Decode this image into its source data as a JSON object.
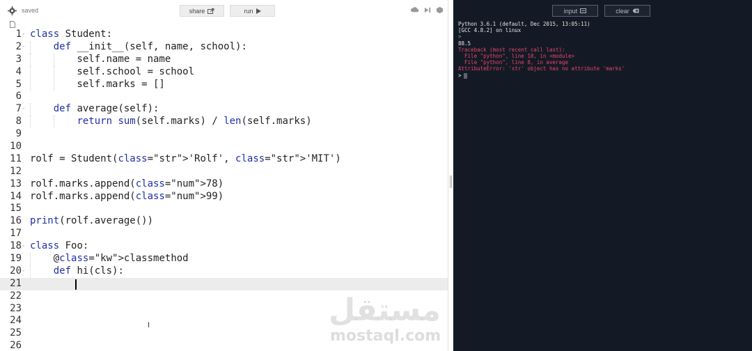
{
  "toolbar": {
    "status": "saved",
    "share_label": "share",
    "run_label": "run"
  },
  "console_toolbar": {
    "input_label": "input",
    "clear_label": "clear"
  },
  "editor": {
    "lines": [
      {
        "n": "1",
        "text": "class Student:"
      },
      {
        "n": "2",
        "text": "    def __init__(self, name, school):"
      },
      {
        "n": "3",
        "text": "        self.name = name"
      },
      {
        "n": "4",
        "text": "        self.school = school"
      },
      {
        "n": "5",
        "text": "        self.marks = []"
      },
      {
        "n": "6",
        "text": ""
      },
      {
        "n": "7",
        "text": "    def average(self):"
      },
      {
        "n": "8",
        "text": "        return sum(self.marks) / len(self.marks)"
      },
      {
        "n": "9",
        "text": ""
      },
      {
        "n": "10",
        "text": ""
      },
      {
        "n": "11",
        "text": "rolf = Student('Rolf', 'MIT')"
      },
      {
        "n": "12",
        "text": ""
      },
      {
        "n": "13",
        "text": "rolf.marks.append(78)"
      },
      {
        "n": "14",
        "text": "rolf.marks.append(99)"
      },
      {
        "n": "15",
        "text": ""
      },
      {
        "n": "16",
        "text": "print(rolf.average())"
      },
      {
        "n": "17",
        "text": ""
      },
      {
        "n": "18",
        "text": "class Foo:"
      },
      {
        "n": "19",
        "text": "    @classmethod"
      },
      {
        "n": "20",
        "text": "    def hi(cls):"
      },
      {
        "n": "21",
        "text": ""
      },
      {
        "n": "22",
        "text": ""
      },
      {
        "n": "23",
        "text": ""
      },
      {
        "n": "24",
        "text": ""
      },
      {
        "n": "25",
        "text": ""
      },
      {
        "n": "26",
        "text": ""
      }
    ],
    "active_line": "21"
  },
  "console": {
    "lines": [
      {
        "kind": "normal",
        "text": "Python 3.6.1 (default, Dec 2015, 13:05:11)"
      },
      {
        "kind": "normal",
        "text": "[GCC 4.8.2] on linux"
      },
      {
        "kind": "prompt",
        "text": ">"
      },
      {
        "kind": "normal",
        "text": "88.5"
      },
      {
        "kind": "error",
        "text": "Traceback (most recent call last):"
      },
      {
        "kind": "error",
        "text": "  File \"python\", line 18, in <module>"
      },
      {
        "kind": "error",
        "text": "  File \"python\", line 8, in average"
      },
      {
        "kind": "error",
        "text": "AttributeError: 'str' object has no attribute 'marks'"
      }
    ],
    "prompt": ">"
  },
  "watermark": {
    "arabic": "مستقل",
    "latin": "mostaql.com"
  },
  "colors": {
    "keyword": "#1f2fa8",
    "string": "#1c7a2a",
    "console_bg": "#141a25",
    "error": "#e8456a"
  }
}
